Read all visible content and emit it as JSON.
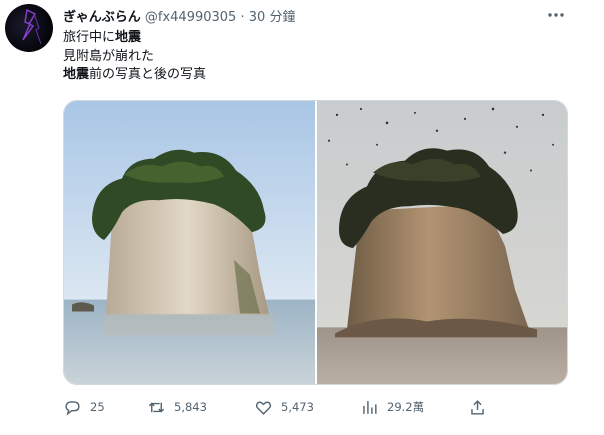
{
  "tweet": {
    "author_name": "ぎゃんぶらん",
    "handle": "@fx44990305",
    "separator": "·",
    "time": "30 分鐘",
    "text_line1": "旅行中に",
    "text_line1_bold": "地震",
    "text_line2": "見附島が崩れた",
    "text_line3_bold": "地震",
    "text_line3_rest": "前の写真と後の写真",
    "avatar_icon": "lightning-avatar",
    "more_icon": "more-icon"
  },
  "actions": {
    "reply_count": "25",
    "retweet_count": "5,843",
    "like_count": "5,473",
    "views_count": "29.2萬",
    "icons": [
      "reply-icon",
      "retweet-icon",
      "like-icon",
      "views-icon",
      "share-icon"
    ]
  },
  "colors": {
    "text": "#0f1419",
    "secondary": "#536471",
    "border": "#cfd9de"
  }
}
